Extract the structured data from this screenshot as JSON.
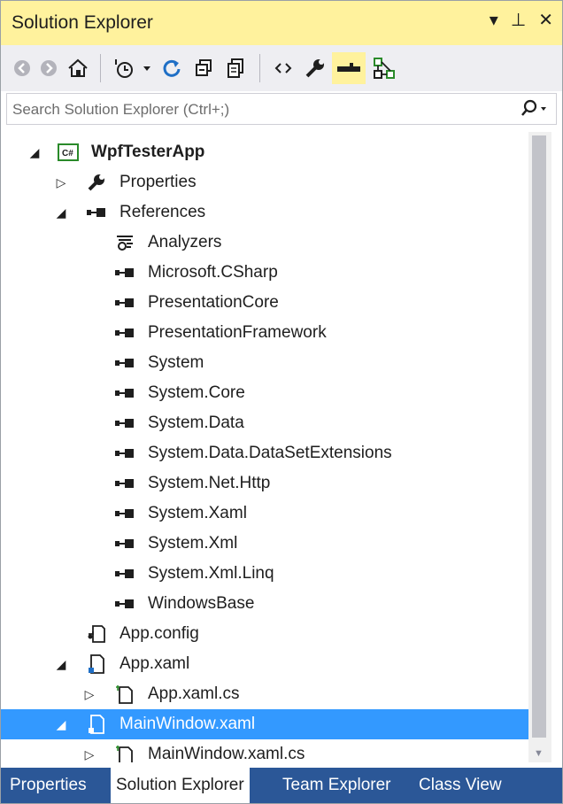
{
  "window": {
    "title": "Solution Explorer",
    "controls": {
      "dropdown": "▾",
      "pin": "⊥",
      "close": "✕"
    }
  },
  "toolbar": {
    "buttons": [
      "back-icon",
      "forward-icon",
      "home-icon",
      "pending-changes-icon",
      "dropdown-icon",
      "refresh-icon",
      "collapse-all-icon",
      "show-all-files-icon",
      "view-code-icon",
      "properties-icon",
      "preview-selected-icon",
      "view-class-diagram-icon"
    ],
    "active": "preview-selected-icon"
  },
  "search": {
    "placeholder": "Search Solution Explorer (Ctrl+;)"
  },
  "tree": {
    "project": "WpfTesterApp",
    "properties": "Properties",
    "references": "References",
    "reference_items": [
      "Analyzers",
      "Microsoft.CSharp",
      "PresentationCore",
      "PresentationFramework",
      "System",
      "System.Core",
      "System.Data",
      "System.Data.DataSetExtensions",
      "System.Net.Http",
      "System.Xaml",
      "System.Xml",
      "System.Xml.Linq",
      "WindowsBase"
    ],
    "app_config": "App.config",
    "app_xaml": "App.xaml",
    "app_xaml_cs": "App.xaml.cs",
    "main_window_xaml": "MainWindow.xaml",
    "main_window_xaml_cs": "MainWindow.xaml.cs",
    "selected": "MainWindow.xaml"
  },
  "tabs": {
    "items": [
      "Properties",
      "Solution Explorer",
      "Team Explorer",
      "Class View"
    ],
    "active": "Solution Explorer"
  },
  "colors": {
    "title_bar": "#fff29d",
    "toolbar": "#eeeef2",
    "selection": "#3399ff",
    "tab_strip": "#2b5797"
  }
}
